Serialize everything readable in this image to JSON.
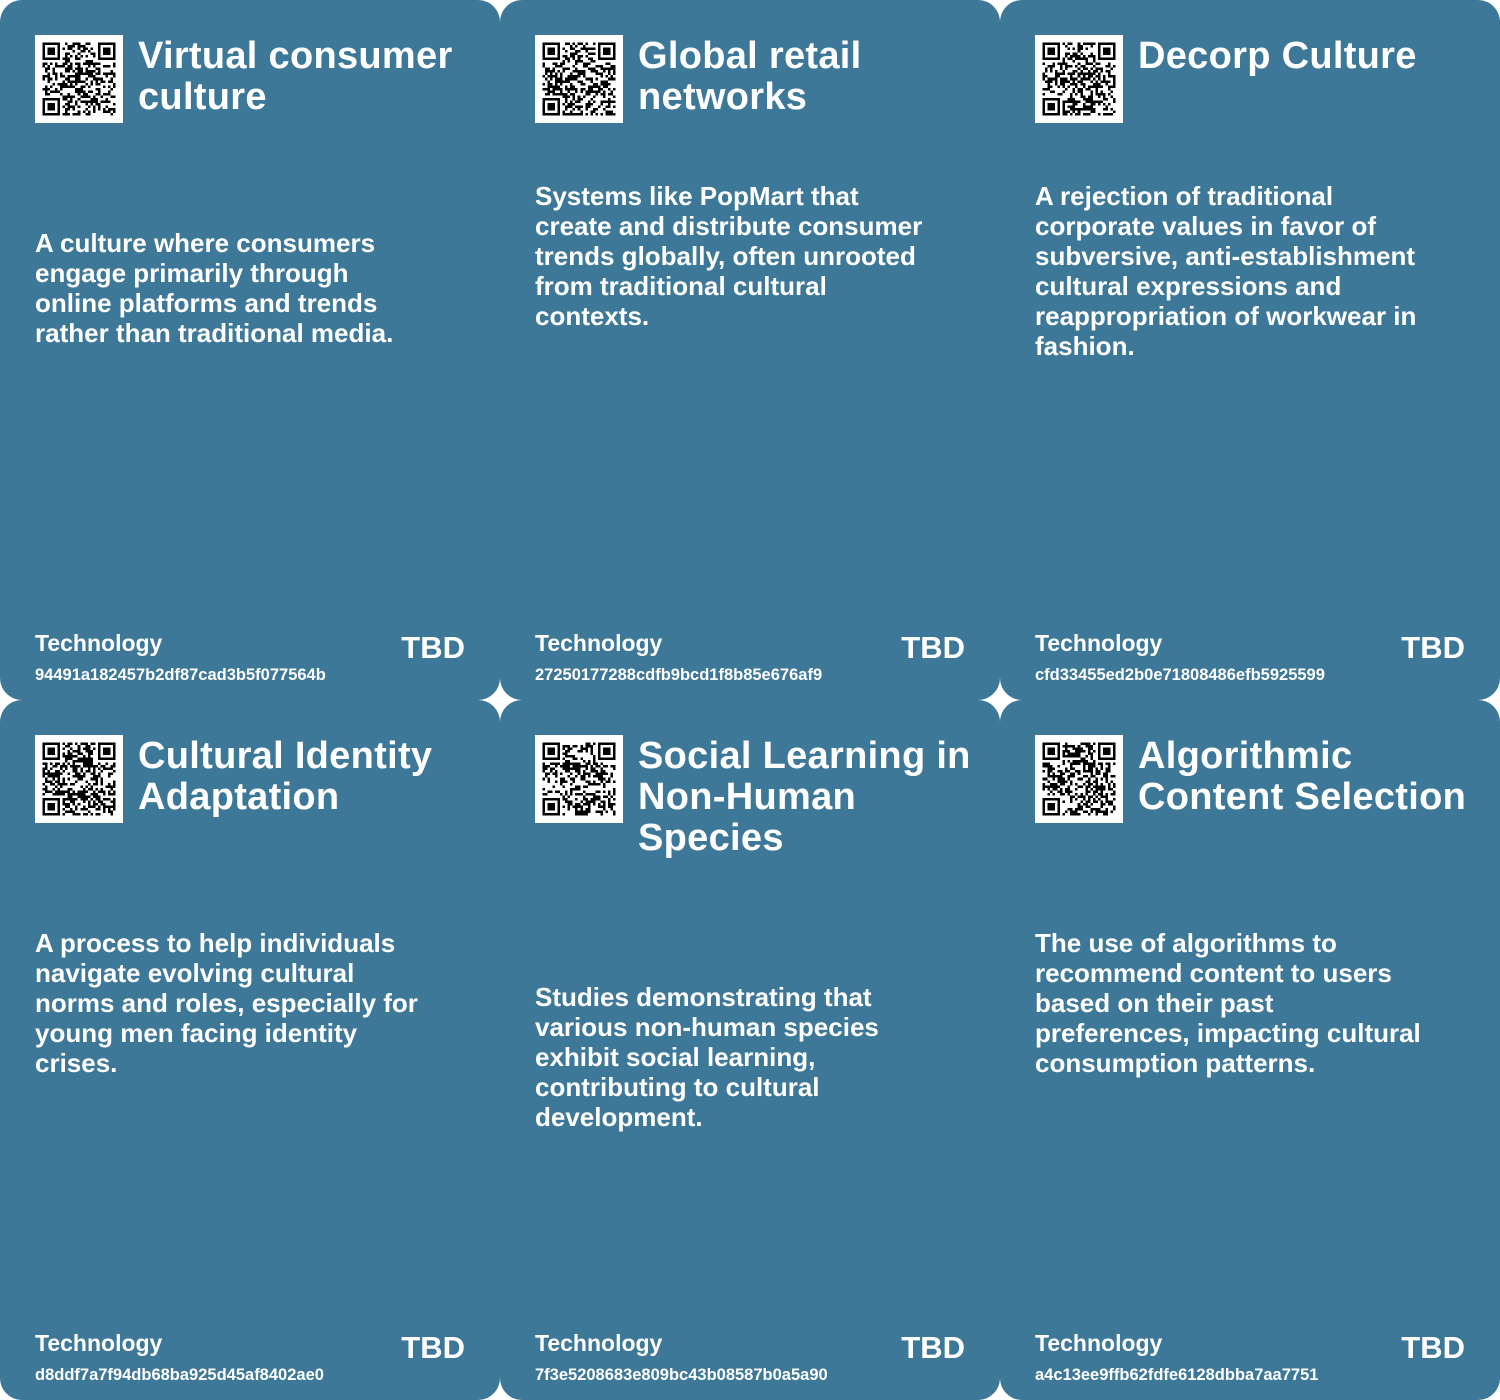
{
  "colors": {
    "card_bg": "#3e7899",
    "text": "#ffffff"
  },
  "cards": [
    {
      "title": "Virtual consumer culture",
      "description": "A culture where consumers engage primarily through online platforms and trends rather than traditional media.",
      "category": "Technology",
      "status": "TBD",
      "hash": "94491a182457b2df87cad3b5f077564b",
      "icon": "qr-code-icon"
    },
    {
      "title": "Global retail networks",
      "description": "Systems like PopMart that create and distribute consumer trends globally, often unrooted from traditional cultural contexts.",
      "category": "Technology",
      "status": "TBD",
      "hash": "27250177288cdfb9bcd1f8b85e676af9",
      "icon": "qr-code-icon"
    },
    {
      "title": "Decorp Culture",
      "description": "A rejection of traditional corporate values in favor of subversive, anti-establishment cultural expressions and reappropriation of workwear in fashion.",
      "category": "Technology",
      "status": "TBD",
      "hash": "cfd33455ed2b0e71808486efb5925599",
      "icon": "qr-code-icon"
    },
    {
      "title": "Cultural Identity Adaptation",
      "description": "A process to help individuals navigate evolving cultural norms and roles, especially for young men facing identity crises.",
      "category": "Technology",
      "status": "TBD",
      "hash": "d8ddf7a7f94db68ba925d45af8402ae0",
      "icon": "qr-code-icon"
    },
    {
      "title": "Social Learning in Non-Human Species",
      "description": "Studies demonstrating that various non-human species exhibit social learning, contributing to cultural development.",
      "category": "Technology",
      "status": "TBD",
      "hash": "7f3e5208683e809bc43b08587b0a5a90",
      "icon": "qr-code-icon"
    },
    {
      "title": "Algorithmic Content Selection",
      "description": "The use of algorithms to recommend content to users based on their past preferences, impacting cultural consumption patterns.",
      "category": "Technology",
      "status": "TBD",
      "hash": "a4c13ee9ffb62fdfe6128dbba7aa7751",
      "icon": "qr-code-icon"
    }
  ]
}
